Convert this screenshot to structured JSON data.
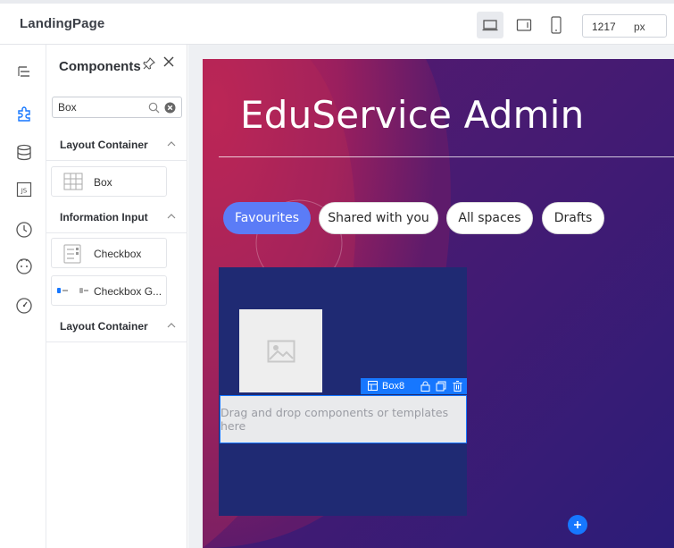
{
  "app": {
    "title": "LandingPage"
  },
  "toolbar": {
    "devices": [
      {
        "icon": "desktop-icon",
        "active": true
      },
      {
        "icon": "tablet-icon",
        "active": false
      },
      {
        "icon": "mobile-icon",
        "active": false
      }
    ],
    "width_value": "1217",
    "width_unit": "px"
  },
  "rail": {
    "icons": [
      "outline-icon",
      "components-icon",
      "database-icon",
      "js-icon",
      "history-icon",
      "face-icon",
      "performance-icon"
    ],
    "active": "components-icon"
  },
  "panel": {
    "title": "Components",
    "search_value": "Box",
    "sections": [
      {
        "label": "Layout Container",
        "items": [
          {
            "label": "Box",
            "icon": "box-grid-icon"
          }
        ]
      },
      {
        "label": "Information Input",
        "items": [
          {
            "label": "Checkbox",
            "icon": "checkbox-icon"
          },
          {
            "label": "Checkbox G...",
            "icon": "checkbox-group-icon"
          }
        ]
      },
      {
        "label": "Layout Container",
        "items": []
      }
    ]
  },
  "canvas": {
    "hero_title": "EduService Admin",
    "tabs": [
      {
        "label": "Favourites",
        "active": true
      },
      {
        "label": "Shared with you",
        "active": false
      },
      {
        "label": "All spaces",
        "active": false
      },
      {
        "label": "Drafts",
        "active": false
      }
    ],
    "selected_box": {
      "name": "Box8"
    },
    "drop_zone_text": "Drag and drop components or templates here"
  },
  "colors": {
    "accent": "#1677ff",
    "tab_active": "#5b7cf7",
    "stage_bg": "#2a1b70",
    "card_bg": "#1f2a73",
    "magenta": "#b4215a"
  }
}
